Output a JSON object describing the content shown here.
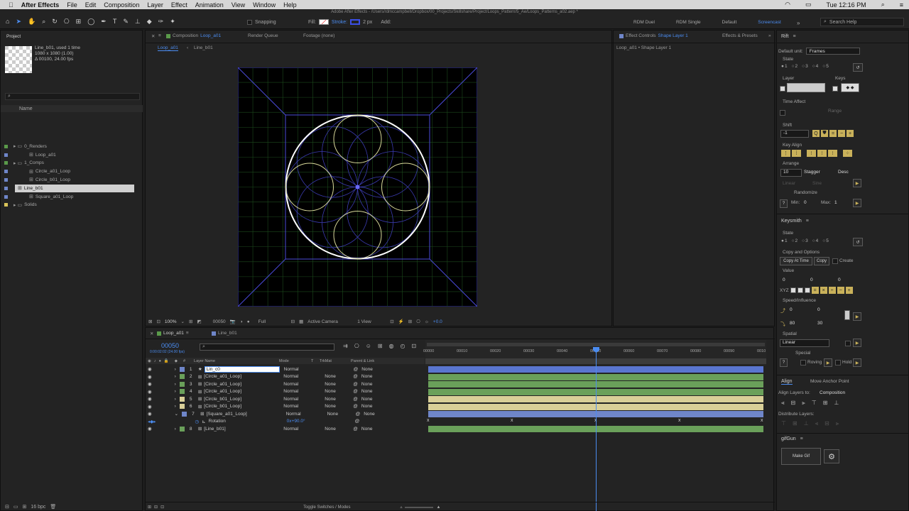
{
  "menubar": {
    "app": "After Effects",
    "items": [
      "File",
      "Edit",
      "Composition",
      "Layer",
      "Effect",
      "Animation",
      "View",
      "Window",
      "Help"
    ],
    "clock": "Tue 12:16 PM",
    "window_title": "Adobe After Effects - /Users/rdmccampbell/Dropbox/00_Projects/Skillshare/Project/Loops_Pattern/5_Ae/Loops_Patterns_a02.aep *"
  },
  "toolbar": {
    "snapping": "Snapping",
    "fill": "Fill:",
    "stroke": "Stroke:",
    "stroke_width": "2 px",
    "add": "Add:",
    "workspaces": [
      "RDM Duel",
      "RDM Single",
      "Default",
      "Screencast"
    ],
    "search_help": "Search Help"
  },
  "project": {
    "tab": "Project",
    "item_name": "Line_b01",
    "used": ", used 1 time",
    "dims": "1080 x 1080 (1.00)",
    "duration": "Δ 00100, 24.00 fps",
    "column": "Name",
    "tree": [
      {
        "label": "0_Renders",
        "type": "folder",
        "level": 0
      },
      {
        "label": "Loop_a01",
        "type": "comp",
        "level": 1
      },
      {
        "label": "1_Comps",
        "type": "folder",
        "level": 0
      },
      {
        "label": "Circle_a01_Loop",
        "type": "comp",
        "level": 1
      },
      {
        "label": "Circle_b01_Loop",
        "type": "comp",
        "level": 1
      },
      {
        "label": "Line_b01",
        "type": "comp",
        "level": 1,
        "selected": true
      },
      {
        "label": "Square_a01_Loop",
        "type": "comp",
        "level": 1
      },
      {
        "label": "Solids",
        "type": "folder",
        "level": 0
      }
    ],
    "bpc": "16 bpc"
  },
  "composition": {
    "tab_prefix": "Composition",
    "tab_name": "Loop_a01",
    "render_queue": "Render Queue",
    "footage": "Footage (none)",
    "breadcrumbs": [
      "Loop_a01",
      "Line_b01"
    ],
    "zoom": "100%",
    "timecode": "00050",
    "resolution": "Full",
    "camera": "Active Camera",
    "view": "1 View",
    "exposure": "+0.0"
  },
  "effect_controls": {
    "tab": "Effect Controls",
    "tab_target": "Shape Layer 1",
    "effects_presets": "Effects & Presets",
    "subtitle": "Loop_a01 • Shape Layer 1"
  },
  "rift": {
    "title": "Rift",
    "default_unit_label": "Default unit:",
    "default_unit": "Frames",
    "state": "State",
    "state_options": [
      "1",
      "2",
      "3",
      "4",
      "5"
    ],
    "layer": "Layer",
    "keys": "Keys",
    "time_affect": "Time Affect",
    "range": "Range",
    "shift": "Shift",
    "shift_value": "-1",
    "key_align": "Key Align",
    "arrange": "Arrange",
    "arrange_value": "10",
    "stagger": "Stagger",
    "desc": "Desc",
    "linear": "Linear",
    "sine": "Sine",
    "randomize": "Randomize",
    "min_label": "Min:",
    "min": "0",
    "max_label": "Max:",
    "max": "1"
  },
  "keysmith": {
    "title": "Keysmith",
    "state": "State",
    "state_options": [
      "1",
      "2",
      "3",
      "4",
      "5"
    ],
    "copy_options": "Copy and Options",
    "copy_at_time": "Copy At Time",
    "copy": "Copy",
    "create": "Create",
    "value": "Value",
    "values": [
      "0",
      "0",
      "0"
    ],
    "xyz": "XYZ",
    "speed_influence": "Speed/Influence",
    "speed_in": "0",
    "speed_out": "0",
    "infl_in": "80",
    "infl_out": "30",
    "spatial": "Spatial",
    "spatial_value": "Linear",
    "special": "Special",
    "roving": "Roving",
    "hold": "Hold"
  },
  "align": {
    "tab": "Align",
    "move_anchor": "Move Anchor Point",
    "align_to_label": "Align Layers to:",
    "align_to": "Composition",
    "distribute": "Distribute Layers:"
  },
  "gifgun": {
    "title": "gifGun",
    "make_gif": "Make Gif"
  },
  "timeline": {
    "tabs": [
      "Loop_a01",
      "Line_b01"
    ],
    "timecode": "00050",
    "timecode_sub": "0:00:02:02 (24.00 fps)",
    "headers": {
      "num": "#",
      "name": "Layer Name",
      "mode": "Mode",
      "t": "T",
      "trkmat": "TrkMat",
      "parent": "Parent & Link"
    },
    "rulers": [
      "00000",
      "00010",
      "00020",
      "00030",
      "00040",
      "00050",
      "00060",
      "00070",
      "00080",
      "00090",
      "0010"
    ],
    "layers": [
      {
        "num": "1",
        "name": "Lin_c0",
        "mode": "Normal",
        "trkmat": "",
        "parent": "None",
        "color": "#6f86c9",
        "editing": true
      },
      {
        "num": "2",
        "name": "[Circle_a01_Loop]",
        "mode": "Normal",
        "trkmat": "None",
        "parent": "None",
        "color": "#6aa05a"
      },
      {
        "num": "3",
        "name": "[Circle_a01_Loop]",
        "mode": "Normal",
        "trkmat": "None",
        "parent": "None",
        "color": "#6aa05a"
      },
      {
        "num": "4",
        "name": "[Circle_a01_Loop]",
        "mode": "Normal",
        "trkmat": "None",
        "parent": "None",
        "color": "#6aa05a"
      },
      {
        "num": "5",
        "name": "[Circle_b01_Loop]",
        "mode": "Normal",
        "trkmat": "None",
        "parent": "None",
        "color": "#d9cf98"
      },
      {
        "num": "6",
        "name": "[Circle_b01_Loop]",
        "mode": "Normal",
        "trkmat": "None",
        "parent": "None",
        "color": "#d9cf98"
      },
      {
        "num": "7",
        "name": "[Square_a01_Loop]",
        "mode": "Normal",
        "trkmat": "None",
        "parent": "None",
        "color": "#6f86c9"
      },
      {
        "num": "8",
        "name": "[Line_b01]",
        "mode": "Normal",
        "trkmat": "None",
        "parent": "None",
        "color": "#6aa05a"
      }
    ],
    "rotation_label": "Rotation",
    "rotation_value": "0x+90.0°",
    "footer": "Toggle Switches / Modes"
  }
}
